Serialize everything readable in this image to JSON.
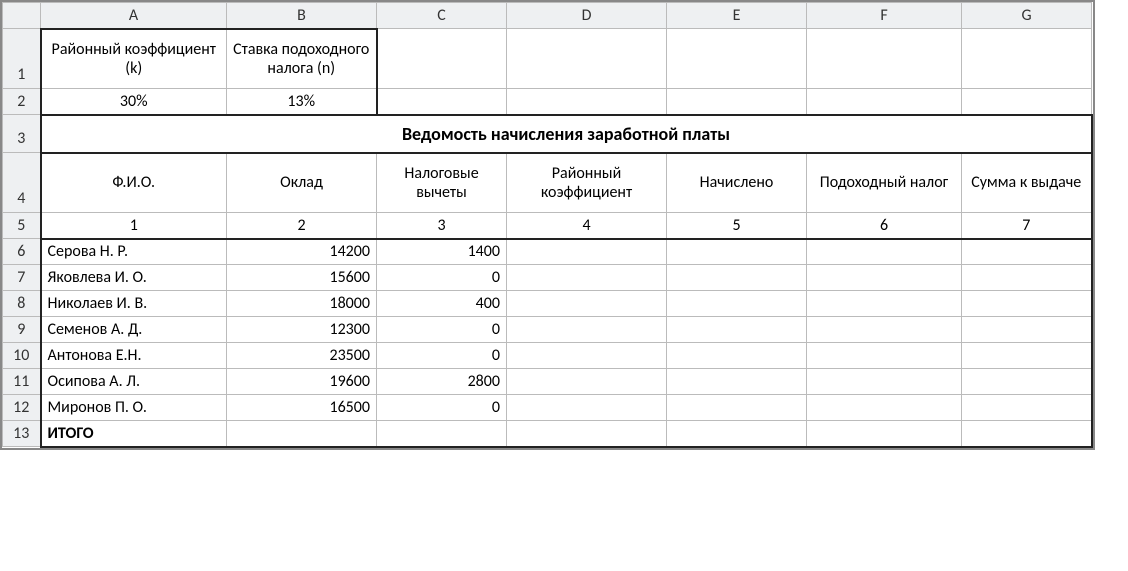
{
  "colHeaders": [
    "A",
    "B",
    "C",
    "D",
    "E",
    "F",
    "G"
  ],
  "rowHeaders": [
    "1",
    "2",
    "3",
    "4",
    "5",
    "6",
    "7",
    "8",
    "9",
    "10",
    "11",
    "12",
    "13"
  ],
  "params": {
    "kLabel": "Районный коэффициент (k)",
    "nLabel": "Ставка подоходного налога (n)",
    "kValue": "30%",
    "nValue": "13%"
  },
  "title": "Ведомость начисления заработной платы",
  "headers": {
    "fio": "Ф.И.О.",
    "salary": "Оклад",
    "deductions": "Налоговые вычеты",
    "regional": "Районный коэффициент",
    "accrued": "Начислено",
    "incomeTax": "Подоходный налог",
    "toPay": "Сумма к выдаче"
  },
  "colNums": [
    "1",
    "2",
    "3",
    "4",
    "5",
    "6",
    "7"
  ],
  "rows": [
    {
      "fio": "Серова Н. Р.",
      "salary": "14200",
      "ded": "1400"
    },
    {
      "fio": "Яковлева И. О.",
      "salary": "15600",
      "ded": "0"
    },
    {
      "fio": "Николаев И. В.",
      "salary": "18000",
      "ded": "400"
    },
    {
      "fio": "Семенов А. Д.",
      "salary": "12300",
      "ded": "0"
    },
    {
      "fio": "Антонова Е.Н.",
      "salary": "23500",
      "ded": "0"
    },
    {
      "fio": "Осипова А. Л.",
      "salary": "19600",
      "ded": "2800"
    },
    {
      "fio": "Миронов П. О.",
      "salary": "16500",
      "ded": "0"
    }
  ],
  "totalLabel": "ИТОГО"
}
